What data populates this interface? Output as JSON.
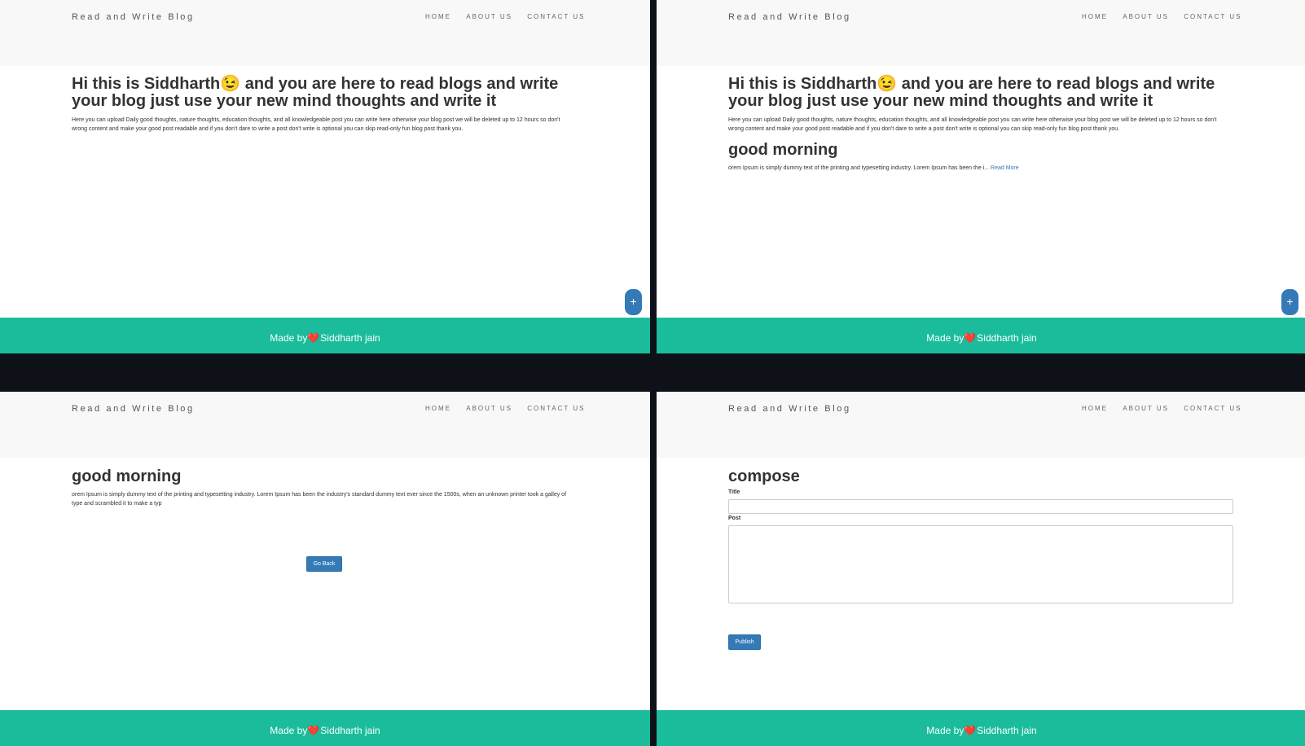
{
  "brand": "Read and Write Blog",
  "nav": {
    "home": "HOME",
    "about": "ABOUT US",
    "contact": "CONTACT US"
  },
  "home": {
    "heading": "Hi this is Siddharth😉 and you are here to read blogs and write your blog just use your new mind thoughts and write it",
    "intro": "Here you can upload Daily good thoughts, nature thoughts, education thoughts, and all knowledgeable post you can write here otherwise your blog post we will be deleted up to 12 hours so don't wrong content and make your good post readable and if you don't dare to write a post don't write is optional you can skip read-only fun blog post thank you."
  },
  "post": {
    "title": "good morning",
    "excerpt": "orem Ipsum is simply dummy text of the printing and typesetting industry. Lorem Ipsum has been the i...",
    "read_more": "Read More",
    "full_text": "orem Ipsum is simply dummy text of the printing and typesetting industry. Lorem Ipsum has been the industry's standard dummy text ever since the 1500s, when an unknown printer took a galley of type and scrambled it to make a typ",
    "go_back": "Go Back"
  },
  "compose": {
    "heading": "compose",
    "title_label": "Title",
    "post_label": "Post",
    "publish": "Publish"
  },
  "fab": {
    "label": "+",
    "icon": "plus-icon"
  },
  "footer": {
    "made_by": "Made by",
    "heart": "❤️",
    "author": "Siddharth jain"
  },
  "colors": {
    "footer": "#1abc9c",
    "primary": "#337ab7",
    "header": "#f8f8f8",
    "divider": "#0e1118"
  }
}
